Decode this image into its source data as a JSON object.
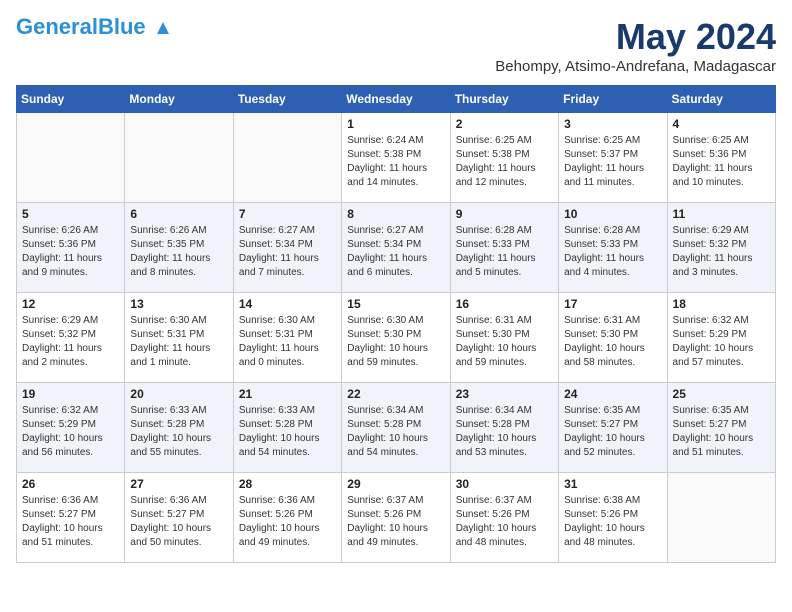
{
  "header": {
    "logo_general": "General",
    "logo_blue": "Blue",
    "month_year": "May 2024",
    "location": "Behompy, Atsimo-Andrefana, Madagascar"
  },
  "days_of_week": [
    "Sunday",
    "Monday",
    "Tuesday",
    "Wednesday",
    "Thursday",
    "Friday",
    "Saturday"
  ],
  "weeks": [
    {
      "alt": false,
      "days": [
        {
          "num": "",
          "text": ""
        },
        {
          "num": "",
          "text": ""
        },
        {
          "num": "",
          "text": ""
        },
        {
          "num": "1",
          "text": "Sunrise: 6:24 AM\nSunset: 5:38 PM\nDaylight: 11 hours and 14 minutes."
        },
        {
          "num": "2",
          "text": "Sunrise: 6:25 AM\nSunset: 5:38 PM\nDaylight: 11 hours and 12 minutes."
        },
        {
          "num": "3",
          "text": "Sunrise: 6:25 AM\nSunset: 5:37 PM\nDaylight: 11 hours and 11 minutes."
        },
        {
          "num": "4",
          "text": "Sunrise: 6:25 AM\nSunset: 5:36 PM\nDaylight: 11 hours and 10 minutes."
        }
      ]
    },
    {
      "alt": true,
      "days": [
        {
          "num": "5",
          "text": "Sunrise: 6:26 AM\nSunset: 5:36 PM\nDaylight: 11 hours and 9 minutes."
        },
        {
          "num": "6",
          "text": "Sunrise: 6:26 AM\nSunset: 5:35 PM\nDaylight: 11 hours and 8 minutes."
        },
        {
          "num": "7",
          "text": "Sunrise: 6:27 AM\nSunset: 5:34 PM\nDaylight: 11 hours and 7 minutes."
        },
        {
          "num": "8",
          "text": "Sunrise: 6:27 AM\nSunset: 5:34 PM\nDaylight: 11 hours and 6 minutes."
        },
        {
          "num": "9",
          "text": "Sunrise: 6:28 AM\nSunset: 5:33 PM\nDaylight: 11 hours and 5 minutes."
        },
        {
          "num": "10",
          "text": "Sunrise: 6:28 AM\nSunset: 5:33 PM\nDaylight: 11 hours and 4 minutes."
        },
        {
          "num": "11",
          "text": "Sunrise: 6:29 AM\nSunset: 5:32 PM\nDaylight: 11 hours and 3 minutes."
        }
      ]
    },
    {
      "alt": false,
      "days": [
        {
          "num": "12",
          "text": "Sunrise: 6:29 AM\nSunset: 5:32 PM\nDaylight: 11 hours and 2 minutes."
        },
        {
          "num": "13",
          "text": "Sunrise: 6:30 AM\nSunset: 5:31 PM\nDaylight: 11 hours and 1 minute."
        },
        {
          "num": "14",
          "text": "Sunrise: 6:30 AM\nSunset: 5:31 PM\nDaylight: 11 hours and 0 minutes."
        },
        {
          "num": "15",
          "text": "Sunrise: 6:30 AM\nSunset: 5:30 PM\nDaylight: 10 hours and 59 minutes."
        },
        {
          "num": "16",
          "text": "Sunrise: 6:31 AM\nSunset: 5:30 PM\nDaylight: 10 hours and 59 minutes."
        },
        {
          "num": "17",
          "text": "Sunrise: 6:31 AM\nSunset: 5:30 PM\nDaylight: 10 hours and 58 minutes."
        },
        {
          "num": "18",
          "text": "Sunrise: 6:32 AM\nSunset: 5:29 PM\nDaylight: 10 hours and 57 minutes."
        }
      ]
    },
    {
      "alt": true,
      "days": [
        {
          "num": "19",
          "text": "Sunrise: 6:32 AM\nSunset: 5:29 PM\nDaylight: 10 hours and 56 minutes."
        },
        {
          "num": "20",
          "text": "Sunrise: 6:33 AM\nSunset: 5:28 PM\nDaylight: 10 hours and 55 minutes."
        },
        {
          "num": "21",
          "text": "Sunrise: 6:33 AM\nSunset: 5:28 PM\nDaylight: 10 hours and 54 minutes."
        },
        {
          "num": "22",
          "text": "Sunrise: 6:34 AM\nSunset: 5:28 PM\nDaylight: 10 hours and 54 minutes."
        },
        {
          "num": "23",
          "text": "Sunrise: 6:34 AM\nSunset: 5:28 PM\nDaylight: 10 hours and 53 minutes."
        },
        {
          "num": "24",
          "text": "Sunrise: 6:35 AM\nSunset: 5:27 PM\nDaylight: 10 hours and 52 minutes."
        },
        {
          "num": "25",
          "text": "Sunrise: 6:35 AM\nSunset: 5:27 PM\nDaylight: 10 hours and 51 minutes."
        }
      ]
    },
    {
      "alt": false,
      "days": [
        {
          "num": "26",
          "text": "Sunrise: 6:36 AM\nSunset: 5:27 PM\nDaylight: 10 hours and 51 minutes."
        },
        {
          "num": "27",
          "text": "Sunrise: 6:36 AM\nSunset: 5:27 PM\nDaylight: 10 hours and 50 minutes."
        },
        {
          "num": "28",
          "text": "Sunrise: 6:36 AM\nSunset: 5:26 PM\nDaylight: 10 hours and 49 minutes."
        },
        {
          "num": "29",
          "text": "Sunrise: 6:37 AM\nSunset: 5:26 PM\nDaylight: 10 hours and 49 minutes."
        },
        {
          "num": "30",
          "text": "Sunrise: 6:37 AM\nSunset: 5:26 PM\nDaylight: 10 hours and 48 minutes."
        },
        {
          "num": "31",
          "text": "Sunrise: 6:38 AM\nSunset: 5:26 PM\nDaylight: 10 hours and 48 minutes."
        },
        {
          "num": "",
          "text": ""
        }
      ]
    }
  ]
}
